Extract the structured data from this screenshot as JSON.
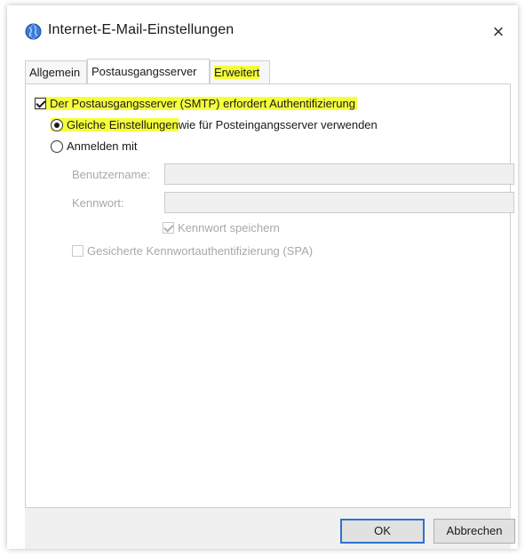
{
  "window": {
    "title": "Internet-E-Mail-Einstellungen",
    "close_glyph": "×"
  },
  "tabs": [
    {
      "label": "Allgemein",
      "active": false
    },
    {
      "label": "Postausgangsserver",
      "active": true
    },
    {
      "label": "Erweitert",
      "active": false
    }
  ],
  "smtp": {
    "auth_required_label": "Der Postausgangsserver (SMTP) erfordert Authentifizierung",
    "auth_required_checked": true,
    "same_settings_label_hl": "Gleiche Einstellungen",
    "same_settings_label_rest": " wie für Posteingangsserver verwenden",
    "same_settings_selected": true,
    "login_with_label": "Anmelden mit",
    "login_with_selected": false,
    "username_label": "Benutzername:",
    "username_value": "",
    "password_label": "Kennwort:",
    "password_value": "",
    "remember_password_label": "Kennwort speichern",
    "remember_password_checked": true,
    "spa_label": "Gesicherte Kennwortauthentifizierung (SPA)",
    "spa_checked": false
  },
  "footer": {
    "ok_label": "OK",
    "cancel_label": "Abbrechen"
  },
  "colors": {
    "highlight": "#f5ff3a",
    "ok_border": "#2f6fd0",
    "disabled_text": "#a8a8a8"
  },
  "icons": {
    "title_icon": "globe-mail-icon",
    "close": "close-icon"
  }
}
